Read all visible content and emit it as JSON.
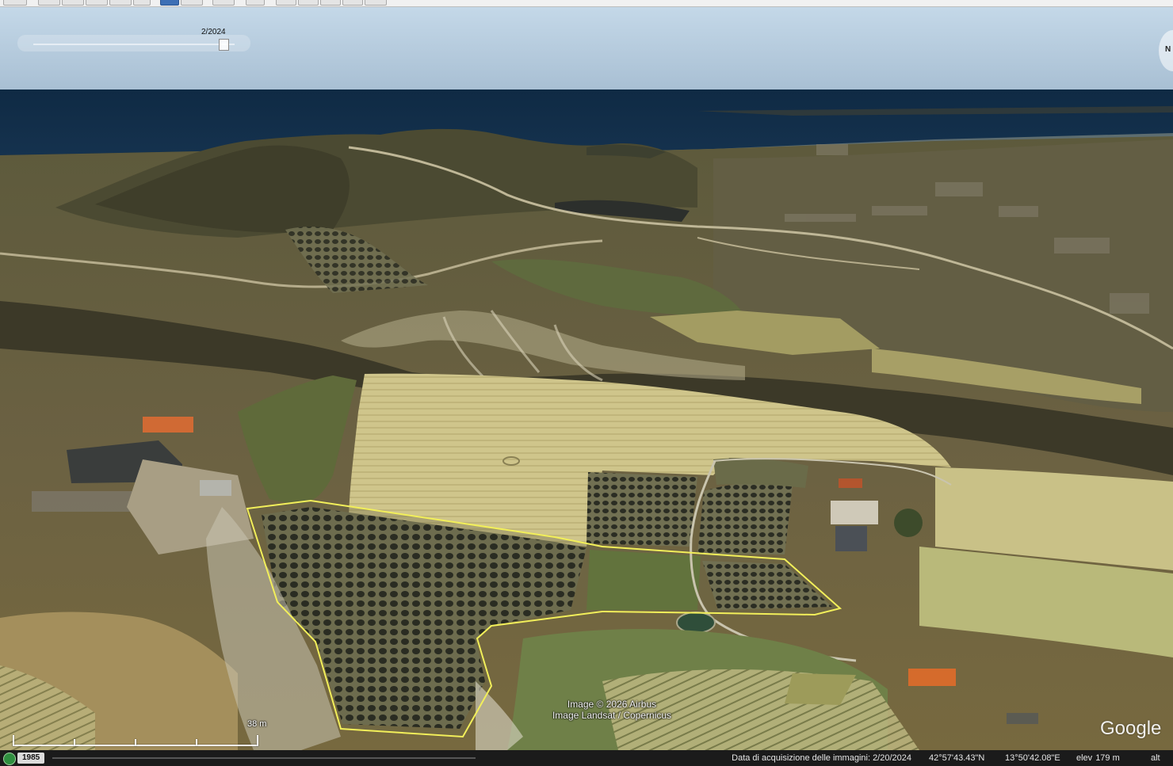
{
  "time_slider": {
    "date": "2/2024"
  },
  "compass": {
    "north": "N"
  },
  "attribution": {
    "line1": "Image © 2026 Airbus",
    "line2": "Image Landsat / Copernicus"
  },
  "logo": "Google",
  "scale": {
    "label": "38 m"
  },
  "status": {
    "year": "1985",
    "acquisition_date": "Data di acquisizione delle immagini: 2/20/2024",
    "latitude": "42°57'43.43\"N",
    "longitude": "13°50'42.08\"E",
    "elev_label": "elev",
    "elev_value": "179 m",
    "alt_label": "alt"
  },
  "colors": {
    "sea": "#132c47",
    "sky": "#bed3e4",
    "polygon": "#f2ef5a"
  },
  "icons": [
    "history-clock-icon",
    "compass-icon"
  ]
}
